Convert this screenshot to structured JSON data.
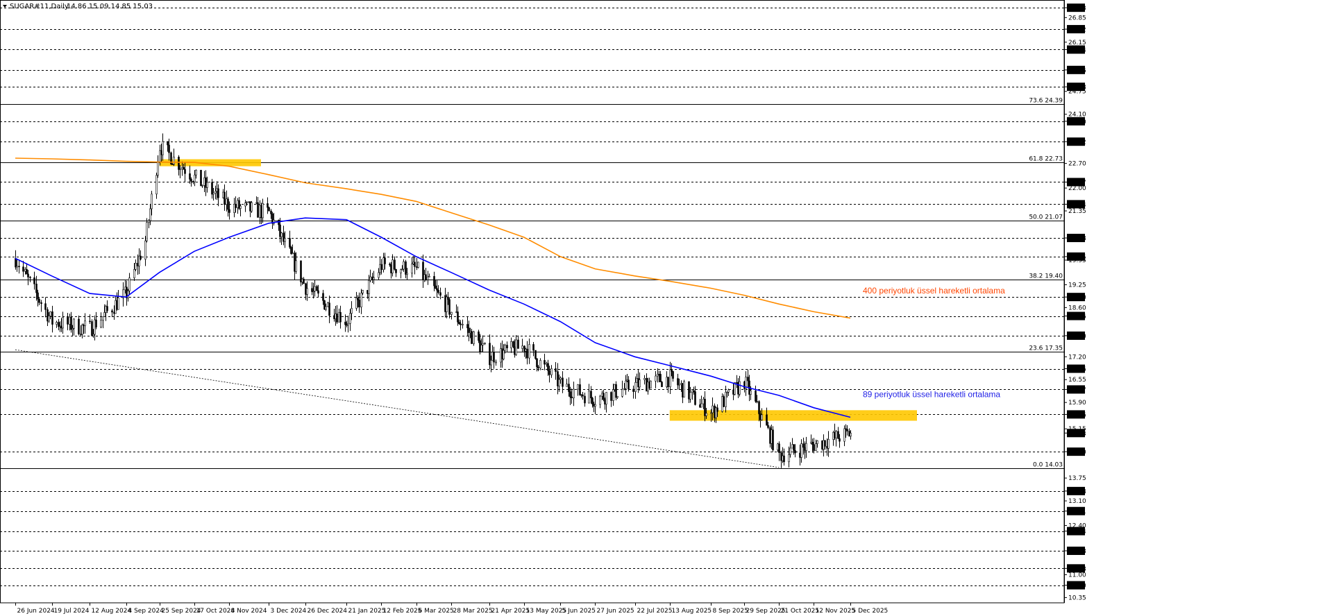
{
  "window": {
    "symbol_label": "SUGAR#11,Daily",
    "ohlc": "14.86 15.09 14.85 15.03",
    "menu_icon": "triangle-down-icon"
  },
  "colors": {
    "background": "#ffffff",
    "candle": "#000000",
    "ema89": "#0000ff",
    "ema400": "#ff8c00",
    "zone": "#ffc800",
    "grid": "#000000",
    "ema400_label": "#ff4500",
    "ema89_label": "#1e1ee6"
  },
  "chart_data": {
    "type": "line",
    "title": "SUGAR#11,Daily",
    "ylim": [
      10.2,
      27.35
    ],
    "grid": "horizontal dashed",
    "current_price": 15.03,
    "x_tick_labels": [
      "26 Jun 2024",
      "19 Jul 2024",
      "12 Aug 2024",
      "4 Sep 2024",
      "25 Sep 2024",
      "17 Oct 2024",
      "8 Nov 2024",
      "3 Dec 2024",
      "26 Dec 2024",
      "21 Jan 2025",
      "12 Feb 2025",
      "6 Mar 2025",
      "28 Mar 2025",
      "21 Apr 2025",
      "13 May 2025",
      "5 Jun 2025",
      "27 Jun 2025",
      "22 Jul 2025",
      "13 Aug 2025",
      "8 Sep 2025",
      "29 Sep 2025",
      "21 Oct 2025",
      "12 Nov 2025",
      "5 Dec 2025"
    ],
    "y_tick_labels": [
      "27.13",
      "26.85",
      "26.52",
      "26.15",
      "25.94",
      "25.36",
      "24.88",
      "24.75",
      "24.10",
      "23.90",
      "23.32",
      "22.70",
      "22.17",
      "22.00",
      "21.54",
      "21.35",
      "20.58",
      "20.05",
      "19.95",
      "19.25",
      "18.90",
      "18.60",
      "18.36",
      "17.80",
      "17.20",
      "16.86",
      "16.55",
      "16.27",
      "15.90",
      "15.56",
      "15.15",
      "15.03",
      "14.50",
      "13.75",
      "13.38",
      "13.10",
      "12.81",
      "12.40",
      "12.24",
      "11.68",
      "11.18",
      "11.00",
      "10.70",
      "10.35"
    ],
    "highlighted_prices": [
      27.13,
      26.52,
      25.94,
      25.36,
      24.88,
      23.9,
      23.32,
      22.17,
      21.54,
      20.58,
      20.05,
      18.9,
      18.36,
      17.8,
      16.86,
      16.27,
      15.56,
      15.03,
      14.5,
      13.38,
      12.81,
      12.24,
      11.68,
      11.18,
      10.7
    ],
    "dashed_levels": [
      27.13,
      26.52,
      25.94,
      25.36,
      24.88,
      23.9,
      23.32,
      22.17,
      21.54,
      20.58,
      20.05,
      18.9,
      18.36,
      17.8,
      16.86,
      16.27,
      15.56,
      14.5,
      13.38,
      12.81,
      12.24,
      11.68,
      11.18,
      10.7
    ],
    "fibonacci": [
      {
        "label": "73.6 24.39",
        "price": 24.39
      },
      {
        "label": "61.8 22.73",
        "price": 22.73
      },
      {
        "label": "50.0 21.07",
        "price": 21.07
      },
      {
        "label": "38.2 19.40",
        "price": 19.4
      },
      {
        "label": "23.6 17.35",
        "price": 17.35
      },
      {
        "label": "0.0 14.03",
        "price": 14.03
      }
    ],
    "price_anchors": [
      [
        "26 Jun 2024",
        20.0
      ],
      [
        "19 Jul 2024",
        18.2
      ],
      [
        "12 Aug 2024",
        18.0
      ],
      [
        "4 Sep 2024",
        19.0
      ],
      [
        "16 Sep 2024",
        20.5
      ],
      [
        "25 Sep 2024",
        23.2
      ],
      [
        "17 Oct 2024",
        22.3
      ],
      [
        "8 Nov 2024",
        21.5
      ],
      [
        "3 Dec 2024",
        21.3
      ],
      [
        "26 Dec 2024",
        19.2
      ],
      [
        "21 Jan 2025",
        18.2
      ],
      [
        "12 Feb 2025",
        19.8
      ],
      [
        "6 Mar 2025",
        19.7
      ],
      [
        "28 Mar 2025",
        18.5
      ],
      [
        "21 Apr 2025",
        17.2
      ],
      [
        "13 May 2025",
        17.5
      ],
      [
        "5 Jun 2025",
        16.4
      ],
      [
        "27 Jun 2025",
        16.0
      ],
      [
        "22 Jul 2025",
        16.4
      ],
      [
        "13 Aug 2025",
        16.6
      ],
      [
        "8 Sep 2025",
        15.6
      ],
      [
        "29 Sep 2025",
        16.5
      ],
      [
        "21 Oct 2025",
        14.4
      ],
      [
        "12 Nov 2025",
        14.7
      ],
      [
        "5 Dec 2025",
        15.03
      ]
    ],
    "series": [
      {
        "name": "89 periyotluk üssel hareketli ortalama",
        "color": "#0000ff",
        "points": [
          [
            "26 Jun 2024",
            20.0
          ],
          [
            "19 Jul 2024",
            19.5
          ],
          [
            "12 Aug 2024",
            19.0
          ],
          [
            "4 Sep 2024",
            18.9
          ],
          [
            "25 Sep 2024",
            19.6
          ],
          [
            "17 Oct 2024",
            20.2
          ],
          [
            "8 Nov 2024",
            20.6
          ],
          [
            "3 Dec 2024",
            21.0
          ],
          [
            "26 Dec 2024",
            21.15
          ],
          [
            "21 Jan 2025",
            21.1
          ],
          [
            "12 Feb 2025",
            20.6
          ],
          [
            "6 Mar 2025",
            20.05
          ],
          [
            "28 Mar 2025",
            19.6
          ],
          [
            "21 Apr 2025",
            19.1
          ],
          [
            "13 May 2025",
            18.7
          ],
          [
            "5 Jun 2025",
            18.2
          ],
          [
            "27 Jun 2025",
            17.6
          ],
          [
            "22 Jul 2025",
            17.2
          ],
          [
            "13 Aug 2025",
            16.95
          ],
          [
            "8 Sep 2025",
            16.65
          ],
          [
            "29 Sep 2025",
            16.35
          ],
          [
            "21 Oct 2025",
            16.1
          ],
          [
            "12 Nov 2025",
            15.75
          ],
          [
            "5 Dec 2025",
            15.48
          ]
        ]
      },
      {
        "name": "400 periyotluk üssel hareketli ortalama",
        "color": "#ff8c00",
        "points": [
          [
            "26 Jun 2024",
            22.85
          ],
          [
            "19 Jul 2024",
            22.83
          ],
          [
            "12 Aug 2024",
            22.8
          ],
          [
            "4 Sep 2024",
            22.76
          ],
          [
            "25 Sep 2024",
            22.74
          ],
          [
            "17 Oct 2024",
            22.73
          ],
          [
            "8 Nov 2024",
            22.62
          ],
          [
            "3 Dec 2024",
            22.38
          ],
          [
            "26 Dec 2024",
            22.15
          ],
          [
            "21 Jan 2025",
            21.98
          ],
          [
            "12 Feb 2025",
            21.82
          ],
          [
            "6 Mar 2025",
            21.62
          ],
          [
            "28 Mar 2025",
            21.3
          ],
          [
            "21 Apr 2025",
            20.95
          ],
          [
            "13 May 2025",
            20.6
          ],
          [
            "5 Jun 2025",
            20.05
          ],
          [
            "27 Jun 2025",
            19.7
          ],
          [
            "22 Jul 2025",
            19.5
          ],
          [
            "13 Aug 2025",
            19.35
          ],
          [
            "8 Sep 2025",
            19.15
          ],
          [
            "29 Sep 2025",
            18.95
          ],
          [
            "21 Oct 2025",
            18.7
          ],
          [
            "12 Nov 2025",
            18.48
          ],
          [
            "5 Dec 2025",
            18.3
          ]
        ]
      }
    ],
    "trendline": {
      "from": [
        "26 Jun 2024",
        17.4
      ],
      "to": [
        "21 Oct 2025",
        14.05
      ]
    },
    "zones": [
      {
        "from": "25 Sep 2024",
        "to": "17 Oct 2024",
        "low": 22.62,
        "high": 22.82
      },
      {
        "from": "13 Aug 2025",
        "to": "5 Dec 2025",
        "low": 15.38,
        "high": 15.68
      }
    ],
    "annotations": [
      {
        "text": "400 periyotluk üssel hareketli ortalama",
        "date": "5 Dec 2025",
        "price": 19.0
      },
      {
        "text": "89 periyotluk üssel hareketli ortalama",
        "date": "5 Dec 2025",
        "price": 16.05
      }
    ]
  }
}
